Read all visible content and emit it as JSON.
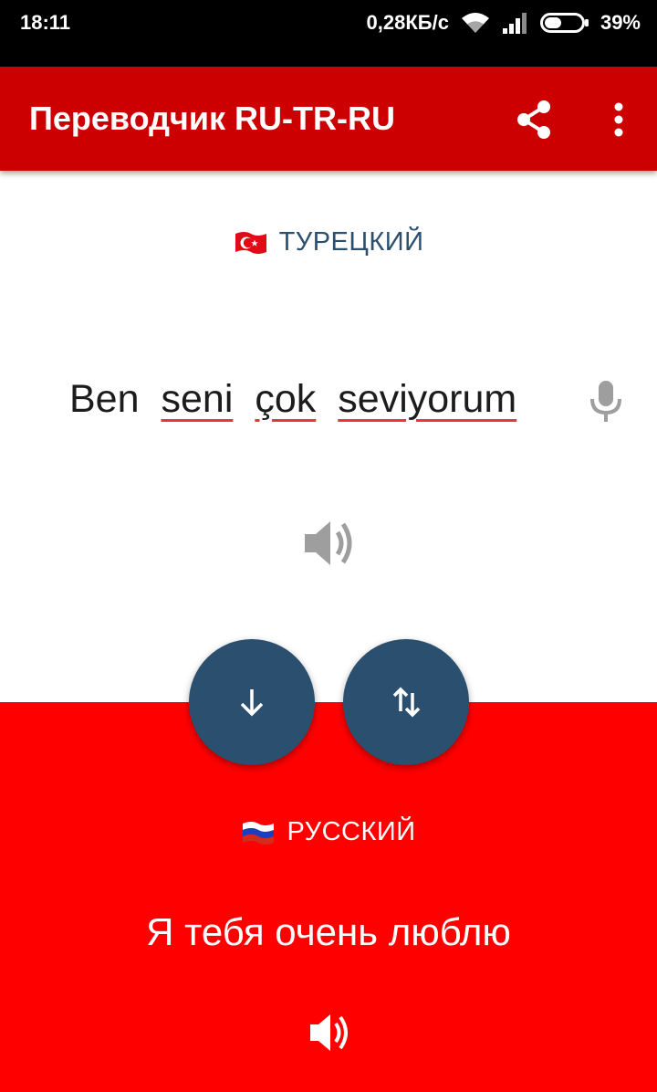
{
  "status_bar": {
    "time": "18:11",
    "network_speed": "0,28КБ/с",
    "battery": "39%",
    "icons": [
      "wifi-icon",
      "signal-icon",
      "battery-icon"
    ]
  },
  "app_bar": {
    "title": "Переводчик RU-TR-RU",
    "background": "#cc0000",
    "icons": [
      "share-icon",
      "more-vert-icon"
    ]
  },
  "source": {
    "language_label": "ТУРЕЦКИЙ",
    "flag": "turkey-flag-icon",
    "words": [
      "Ben",
      "seni",
      "çok",
      "seviyorum"
    ],
    "icons": [
      "mic-icon",
      "speaker-icon"
    ],
    "label_color": "#2b4f6e"
  },
  "actions": {
    "icons": [
      "arrow-down-icon",
      "swap-vertical-icon"
    ],
    "button_color": "#2b4f6e"
  },
  "target": {
    "language_label": "РУССКИЙ",
    "flag": "russia-flag-icon",
    "text": "Я тебя очень люблю",
    "background": "#ff0000",
    "icons": [
      "speaker-icon"
    ]
  }
}
